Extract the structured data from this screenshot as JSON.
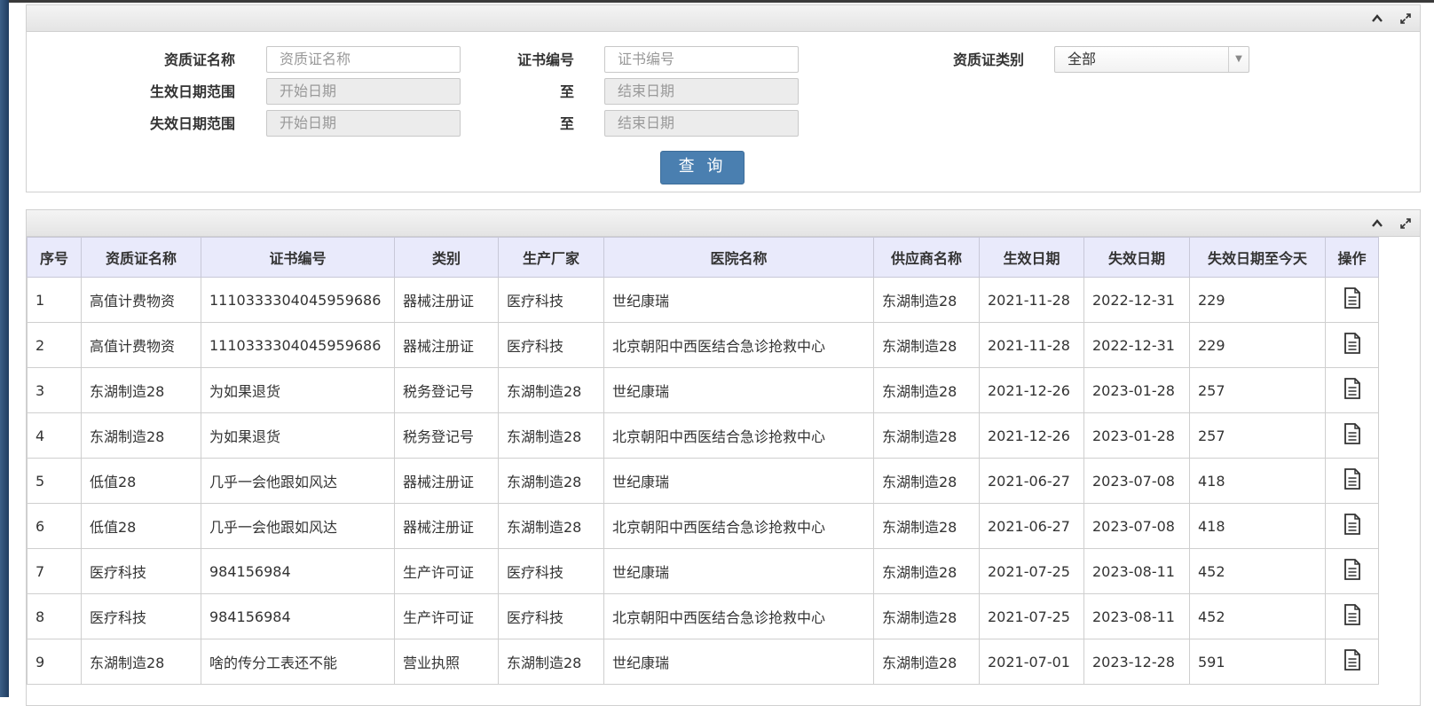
{
  "search": {
    "name_label": "资质证名称",
    "name_placeholder": "资质证名称",
    "cert_no_label": "证书编号",
    "cert_no_placeholder": "证书编号",
    "type_label": "资质证类别",
    "type_selected": "全部",
    "effective_label": "生效日期范围",
    "expire_label": "失效日期范围",
    "to_label": "至",
    "start_placeholder": "开始日期",
    "end_placeholder": "结束日期",
    "query_button": "查 询"
  },
  "table": {
    "headers": [
      "序号",
      "资质证名称",
      "证书编号",
      "类别",
      "生产厂家",
      "医院名称",
      "供应商名称",
      "生效日期",
      "失效日期",
      "失效日期至今天",
      "操作"
    ],
    "rows": [
      [
        "1",
        "高值计费物资",
        "1110333304045959686",
        "器械注册证",
        "医疗科技",
        "世纪康瑞",
        "东湖制造28",
        "2021-11-28",
        "2022-12-31",
        "229"
      ],
      [
        "2",
        "高值计费物资",
        "1110333304045959686",
        "器械注册证",
        "医疗科技",
        "北京朝阳中西医结合急诊抢救中心",
        "东湖制造28",
        "2021-11-28",
        "2022-12-31",
        "229"
      ],
      [
        "3",
        "东湖制造28",
        "为如果退货",
        "税务登记号",
        "东湖制造28",
        "世纪康瑞",
        "东湖制造28",
        "2021-12-26",
        "2023-01-28",
        "257"
      ],
      [
        "4",
        "东湖制造28",
        "为如果退货",
        "税务登记号",
        "东湖制造28",
        "北京朝阳中西医结合急诊抢救中心",
        "东湖制造28",
        "2021-12-26",
        "2023-01-28",
        "257"
      ],
      [
        "5",
        "低值28",
        "几乎一会他跟如风达",
        "器械注册证",
        "东湖制造28",
        "世纪康瑞",
        "东湖制造28",
        "2021-06-27",
        "2023-07-08",
        "418"
      ],
      [
        "6",
        "低值28",
        "几乎一会他跟如风达",
        "器械注册证",
        "东湖制造28",
        "北京朝阳中西医结合急诊抢救中心",
        "东湖制造28",
        "2021-06-27",
        "2023-07-08",
        "418"
      ],
      [
        "7",
        "医疗科技",
        "984156984",
        "生产许可证",
        "医疗科技",
        "世纪康瑞",
        "东湖制造28",
        "2021-07-25",
        "2023-08-11",
        "452"
      ],
      [
        "8",
        "医疗科技",
        "984156984",
        "生产许可证",
        "医疗科技",
        "北京朝阳中西医结合急诊抢救中心",
        "东湖制造28",
        "2021-07-25",
        "2023-08-11",
        "452"
      ],
      [
        "9",
        "东湖制造28",
        "啥的传分工表还不能",
        "营业执照",
        "东湖制造28",
        "世纪康瑞",
        "东湖制造28",
        "2021-07-01",
        "2023-12-28",
        "591"
      ]
    ]
  },
  "icons": {
    "collapse": "chevron-up-icon",
    "expand": "expand-icon",
    "row_action": "document-icon"
  },
  "colors": {
    "header_bg": "#e9eafb",
    "button_bg": "#4a7fb0",
    "sidebar": "#2b4a70"
  }
}
